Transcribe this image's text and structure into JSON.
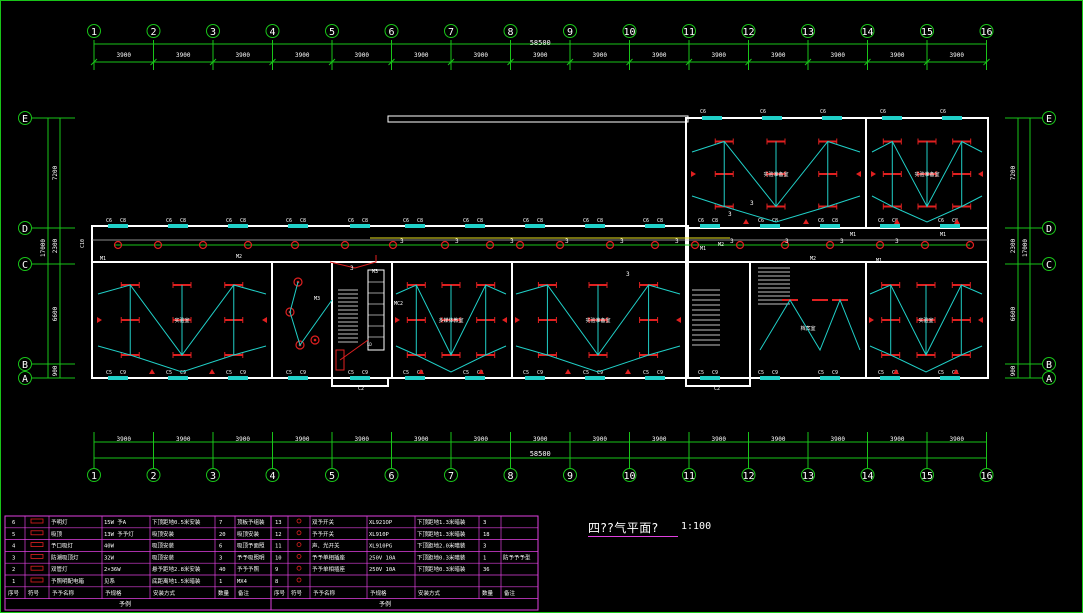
{
  "drawing": {
    "title": "四??气平面?",
    "scale": "1:100"
  },
  "axes": {
    "columns": [
      "1",
      "2",
      "3",
      "4",
      "5",
      "6",
      "7",
      "8",
      "9",
      "10",
      "11",
      "12",
      "13",
      "14",
      "15",
      "16"
    ],
    "spans": [
      "3900",
      "3900",
      "3900",
      "3900",
      "3900",
      "3900",
      "3900",
      "3900",
      "3900",
      "3900",
      "3900",
      "3900",
      "3900",
      "3900",
      "3900"
    ],
    "total": "58500",
    "rows_left": [
      "E",
      "D",
      "C",
      "B",
      "A"
    ],
    "row_spans": [
      "7200",
      "2300",
      "6600",
      "900"
    ],
    "row_total": "17000"
  },
  "rooms": [
    "实验准备室",
    "实验准备室",
    "实验准备室",
    "多媒体教室",
    "实验准备室",
    "资料室",
    "档案室",
    "实验室",
    "实验室"
  ],
  "labels": {
    "circuit": "3",
    "m1": "M1",
    "m2": "M2",
    "m3": "M3",
    "mc2": "MC2",
    "c2": "C2",
    "c6": "C6",
    "c5": "C5",
    "c8": "C8",
    "c9": "C9",
    "c10": "C10",
    "ld": "LD"
  },
  "legend": {
    "footer_left": "予例",
    "footer_right": "予例",
    "header_left": [
      "序号",
      "符号",
      "予予名称",
      "予规格",
      "安装方式",
      "数量",
      "备注"
    ],
    "header_right": [
      "序号",
      "符号",
      "予予名称",
      "予规格",
      "安装方式",
      "数量",
      "备注"
    ],
    "rows_left": [
      {
        "no": "6",
        "name": "予明灯",
        "spec": "15W 予A",
        "install": "下顶距地0.5米安装",
        "qty": "7",
        "note": "顶板予组装"
      },
      {
        "no": "5",
        "name": "吸顶",
        "spec": "13W 予予灯",
        "install": "吸顶安装",
        "qty": "20",
        "note": "吸顶安装"
      },
      {
        "no": "4",
        "name": "予口吸灯",
        "spec": "40W",
        "install": "吸顶安装",
        "qty": "6",
        "note": "吸顶予面照"
      },
      {
        "no": "3",
        "name": "防潮吸顶灯",
        "spec": "32W",
        "install": "吸顶安装",
        "qty": "3",
        "note": "予予吸照明"
      },
      {
        "no": "2",
        "name": "双管灯",
        "spec": "2×36W",
        "install": "悬予距地2.8米安装",
        "qty": "40",
        "note": "予予予照"
      },
      {
        "no": "1",
        "name": "予照明配电箱",
        "spec": "见系",
        "install": "底距离地1.5米暗装",
        "qty": "1",
        "note": "MX4"
      }
    ],
    "rows_right": [
      {
        "no": "13",
        "name": "双予开关",
        "spec": "XL921OP",
        "install": "下顶距地1.3米暗装",
        "qty": "3",
        "note": ""
      },
      {
        "no": "12",
        "name": "予予开关",
        "spec": "XL910P",
        "install": "下顶距地1.3米暗装",
        "qty": "18",
        "note": ""
      },
      {
        "no": "11",
        "name": "声、光开关",
        "spec": "XL910PG",
        "install": "下顶距地2.0米暗装",
        "qty": "3",
        "note": ""
      },
      {
        "no": "10",
        "name": "予予单相插座",
        "spec": "250V 10A",
        "install": "下顶距地0.3米暗装",
        "qty": "1",
        "note": "防予予予型"
      },
      {
        "no": "9",
        "name": "予予单相插座",
        "spec": "250V 10A",
        "install": "下顶距地0.3米暗装",
        "qty": "36",
        "note": ""
      },
      {
        "no": "8",
        "name": "",
        "spec": "",
        "install": "",
        "qty": "",
        "note": ""
      }
    ]
  }
}
